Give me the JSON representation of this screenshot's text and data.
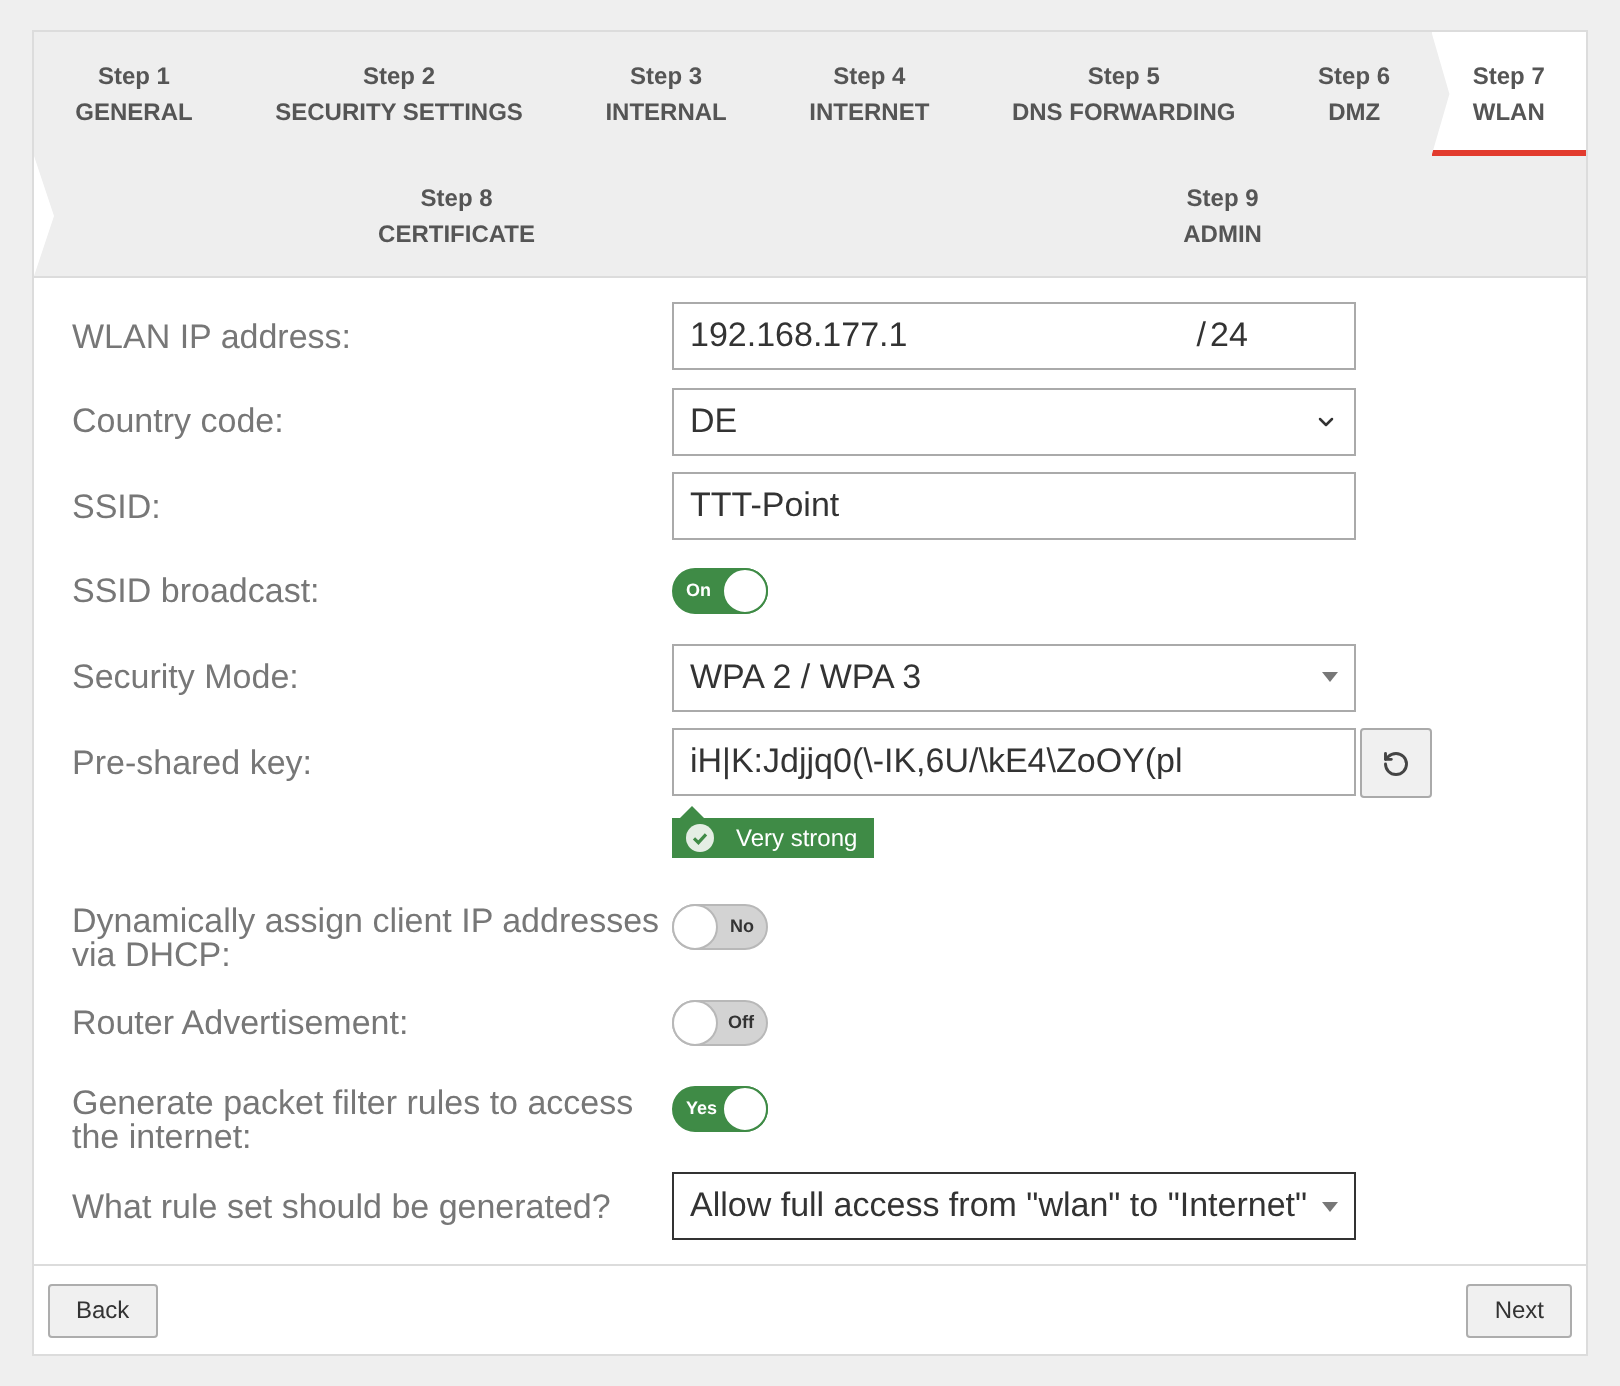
{
  "step_rows": [
    {
      "steps": [
        {
          "number": "Step 1",
          "title": "GENERAL",
          "selected": false
        },
        {
          "number": "Step 2",
          "title": "SECURITY SETTINGS",
          "selected": false
        },
        {
          "number": "Step 3",
          "title": "INTERNAL",
          "selected": false
        },
        {
          "number": "Step 4",
          "title": "INTERNET",
          "selected": false
        },
        {
          "number": "Step 5",
          "title": "DNS FORWARDING",
          "selected": false
        },
        {
          "number": "Step 6",
          "title": "DMZ",
          "selected": false
        },
        {
          "number": "Step 7",
          "title": "WLAN",
          "selected": true
        }
      ]
    },
    {
      "steps": [
        {
          "number": "Step 8",
          "title": "CERTIFICATE",
          "selected": false
        },
        {
          "number": "Step 9",
          "title": "ADMIN",
          "selected": false
        }
      ]
    }
  ],
  "form": {
    "rows": [
      {
        "kind": "ip",
        "label": "WLAN IP address:",
        "value": "192.168.177.1",
        "prefix_separator": "/",
        "prefix": "24"
      },
      {
        "kind": "select",
        "label": "Country code:",
        "value": "DE"
      },
      {
        "kind": "text",
        "label": "SSID:",
        "value": "TTT-Point"
      },
      {
        "kind": "toggle",
        "label": "SSID broadcast:",
        "on": true,
        "toggle_text": "On"
      },
      {
        "kind": "dropdown",
        "label": "Security Mode:",
        "value": "WPA 2 / WPA 3",
        "focused": false
      },
      {
        "kind": "password",
        "label": "Pre-shared key:",
        "value": "iH|K:Jdjjq0(\\-IK,6U/\\kE4\\ZoOY(pl",
        "strength": "Very strong"
      },
      {
        "kind": "toggle",
        "label": "Dynamically assign client IP addresses via DHCP:",
        "on": false,
        "toggle_text": "No"
      },
      {
        "kind": "toggle",
        "label": "Router Advertisement:",
        "on": false,
        "toggle_text": "Off"
      },
      {
        "kind": "toggle",
        "label": "Generate packet filter rules to access the internet:",
        "on": true,
        "toggle_text": "Yes"
      },
      {
        "kind": "dropdown",
        "label": "What rule set should be generated?",
        "value": "Allow full access from \"wlan\" to \"Internet\"",
        "focused": true
      }
    ]
  },
  "buttons": [
    {
      "kind": "back",
      "label": "Back"
    },
    {
      "kind": "next",
      "label": "Next"
    }
  ]
}
